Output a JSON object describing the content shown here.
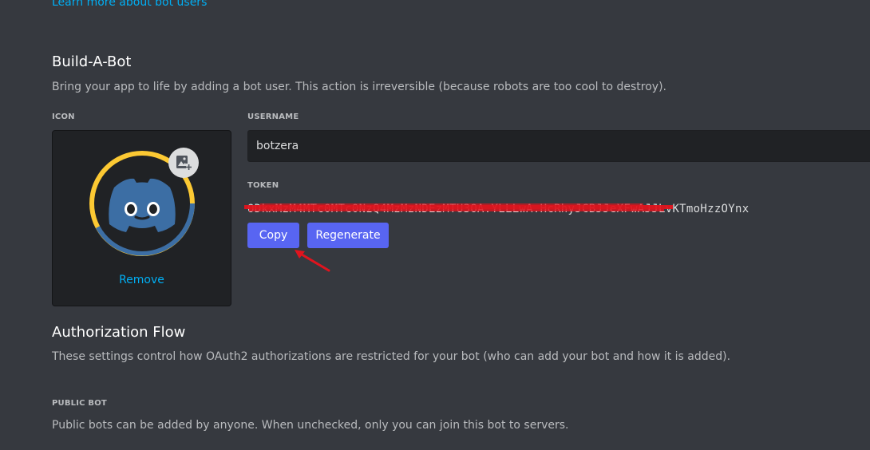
{
  "top_link": "Learn more about bot users",
  "build_a_bot": {
    "title": "Build-A-Bot",
    "description": "Bring your app to life by adding a bot user. This action is irreversible (because robots are too cool to destroy).",
    "icon_label": "ICON",
    "remove_label": "Remove",
    "username_label": "USERNAME",
    "username_value": "botzera",
    "token_label": "TOKEN",
    "token_value": "ODkxMzM4MTc0MTc0NzQ4MzMzNDEzMTU3OA.YLLLwA.HcRhyJCBJJeXFwAJJLvKTmoHzzOYnx",
    "copy_label": "Copy",
    "regenerate_label": "Regenerate"
  },
  "authorization_flow": {
    "title": "Authorization Flow",
    "description": "These settings control how OAuth2 authorizations are restricted for your bot (who can add your bot and how it is added)."
  },
  "public_bot": {
    "label": "PUBLIC BOT",
    "description": "Public bots can be added by anyone. When unchecked, only you can join this bot to servers."
  },
  "colors": {
    "accent": "#5865f2",
    "link": "#00aff4",
    "background": "#36393f",
    "avatar_ring_yellow": "#fcc933",
    "avatar_ring_blue": "#3c6ea4",
    "annotation_red": "#e0141e"
  },
  "icons": [
    "upload-image-icon",
    "discord-logo-icon",
    "annotation-arrow"
  ]
}
